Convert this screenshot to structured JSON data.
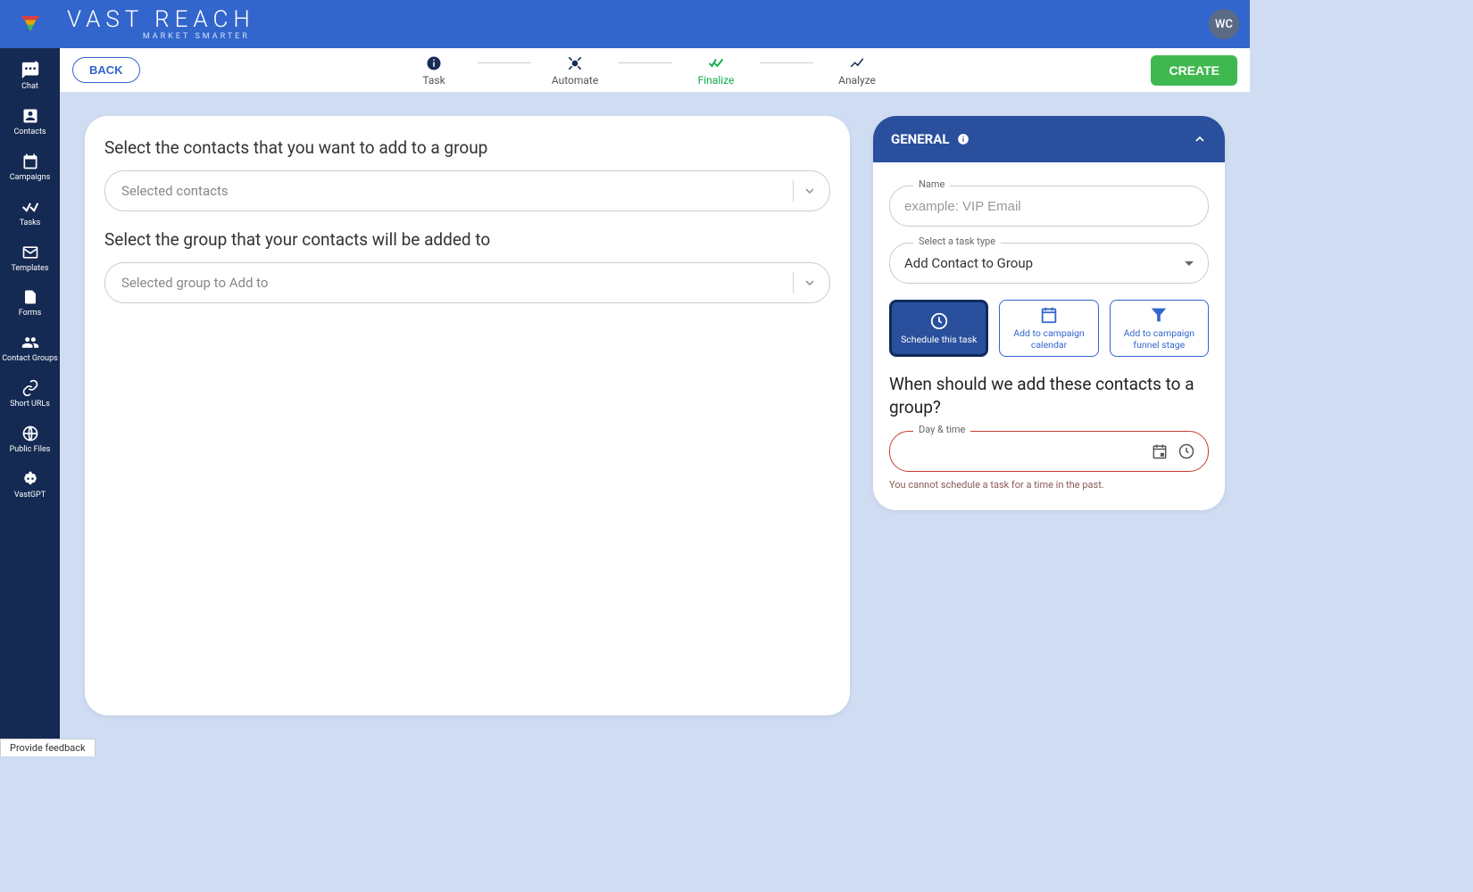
{
  "header": {
    "brand_main": "VAST REACH",
    "brand_sub": "MARKET SMARTER",
    "avatar_initials": "WC"
  },
  "sidebar": {
    "items": [
      {
        "name": "chat",
        "label": "Chat"
      },
      {
        "name": "contacts",
        "label": "Contacts"
      },
      {
        "name": "campaigns",
        "label": "Campaigns"
      },
      {
        "name": "tasks",
        "label": "Tasks"
      },
      {
        "name": "templates",
        "label": "Templates"
      },
      {
        "name": "forms",
        "label": "Forms"
      },
      {
        "name": "contact-groups",
        "label": "Contact Groups"
      },
      {
        "name": "short-urls",
        "label": "Short URLs"
      },
      {
        "name": "public-files",
        "label": "Public Files"
      },
      {
        "name": "vastgpt",
        "label": "VastGPT"
      }
    ]
  },
  "toolbar": {
    "back_label": "BACK",
    "create_label": "CREATE",
    "steps": [
      {
        "label": "Task"
      },
      {
        "label": "Automate"
      },
      {
        "label": "Finalize"
      },
      {
        "label": "Analyze"
      }
    ]
  },
  "main": {
    "prompt_contacts": "Select the contacts that you want to add to a group",
    "placeholder_contacts": "Selected contacts",
    "prompt_group": "Select the group that your contacts will be added to",
    "placeholder_group": "Selected group to Add to"
  },
  "panel": {
    "title": "GENERAL",
    "name_label": "Name",
    "name_placeholder": "example: VIP Email",
    "task_type_label": "Select a task type",
    "task_type_value": "Add Contact to Group",
    "options": [
      {
        "label": "Schedule this task"
      },
      {
        "label": "Add to campaign calendar"
      },
      {
        "label": "Add to campaign funnel stage"
      }
    ],
    "schedule_heading": "When should we add these contacts to a group?",
    "datetime_label": "Day & time",
    "error_msg": "You cannot schedule a task for a time in the past."
  },
  "feedback_label": "Provide feedback"
}
